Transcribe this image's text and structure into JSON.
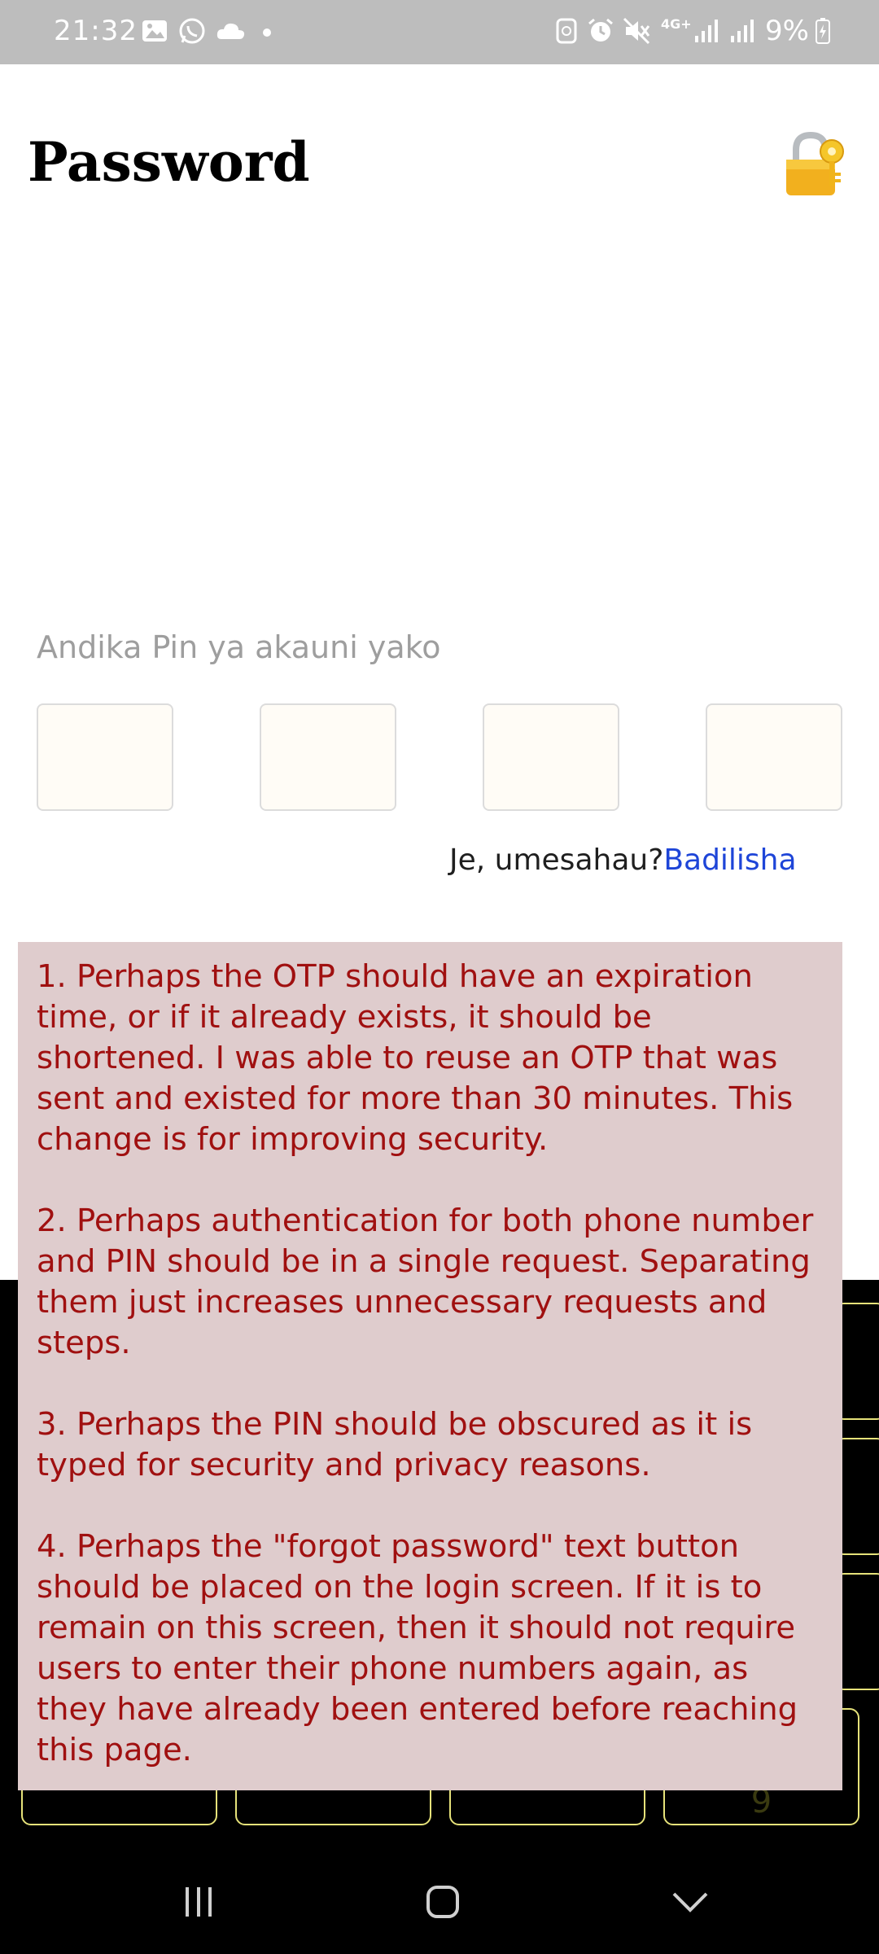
{
  "status_bar": {
    "time": "21:32",
    "battery_percent": "9%",
    "network": "4G+",
    "left_icons": [
      "image-icon",
      "whatsapp-icon",
      "cloud-icon",
      "dot-icon"
    ],
    "right_icons": [
      "recycle-icon",
      "alarm-icon",
      "mute-icon",
      "signal-icon",
      "signal-icon",
      "battery-icon"
    ]
  },
  "header": {
    "title": "Password",
    "icon": "lock-with-key-icon"
  },
  "pin": {
    "label": "Andika Pin ya akauni yako",
    "box_count": 4,
    "box_color": "#fffcf6"
  },
  "forgot": {
    "prompt": "Je, umesahau?",
    "link": "Badilisha",
    "link_color": "#1e45d8"
  },
  "keypad": {
    "partially_visible_key": "9",
    "border_color": "#e6e27a"
  },
  "nav_bar": {
    "icons": [
      "recent-apps-icon",
      "home-icon",
      "back-icon"
    ]
  },
  "feedback": {
    "background": "#dfcccd",
    "text_color": "#a01010",
    "items": [
      "1. Perhaps the OTP should have an expiration time, or if it already exists, it should be shortened. I was able to reuse an OTP that was sent and existed for more than 30 minutes. This change is for improving security.",
      "2. Perhaps authentication for both phone number and PIN should be in a single request. Separating them just increases unnecessary requests and steps.",
      "3. Perhaps the PIN should be obscured as it is typed for security and privacy reasons.",
      "4. Perhaps the \"forgot password\" text button should be placed on the login screen. If it is to remain on this screen, then it should not require users to enter their phone numbers again, as they have already been entered before reaching this page."
    ]
  }
}
